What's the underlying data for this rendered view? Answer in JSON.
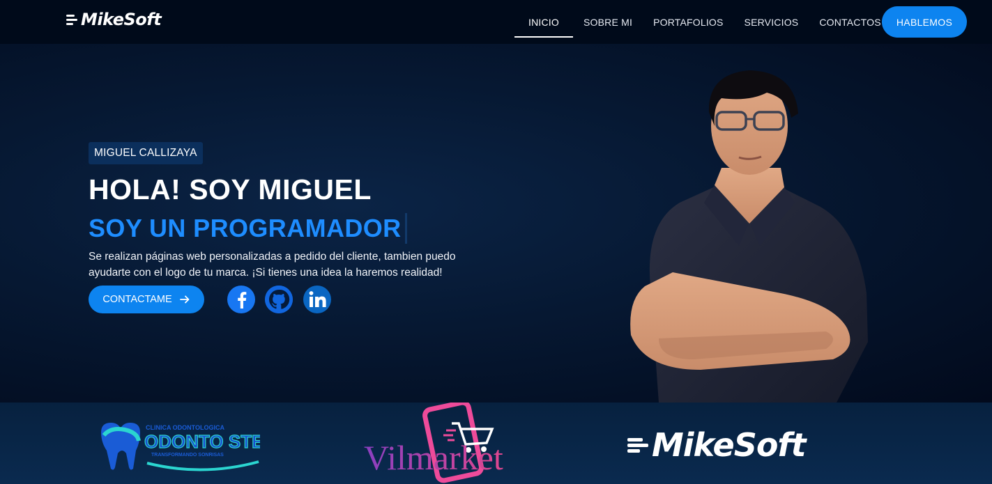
{
  "nav": {
    "brand": "MikeSoft",
    "links": [
      "INICIO",
      "SOBRE MI",
      "PORTAFOLIOS",
      "SERVICIOS",
      "CONTACTOS"
    ],
    "cta": "HABLEMOS"
  },
  "hero": {
    "tag": "MIGUEL CALLIZAYA",
    "headline": "HOLA! SOY MIGUEL",
    "subheadline": "SOY UN PROGRAMADOR",
    "description_line1": "Se realizan páginas web personalizadas a pedido del cliente, tambien puedo",
    "description_line2": "ayudarte con el logo de tu marca. ¡Si tienes una idea la haremos realidad!",
    "contact_button": "CONTACTAME",
    "social": [
      "facebook-icon",
      "github-icon",
      "linkedin-icon"
    ]
  },
  "clients": {
    "odonto_top": "CLINICA ODONTOLOGICA",
    "odonto_main": "ODONTO STETIC",
    "odonto_tagline": "TRANSFORMANDO SONRISAS",
    "vilmarket": "Vilmarket",
    "mikesoft": "MikeSoft"
  },
  "colors": {
    "accent": "#0d84f0",
    "subheadline": "#1e8dff",
    "background": "#020a1c"
  }
}
